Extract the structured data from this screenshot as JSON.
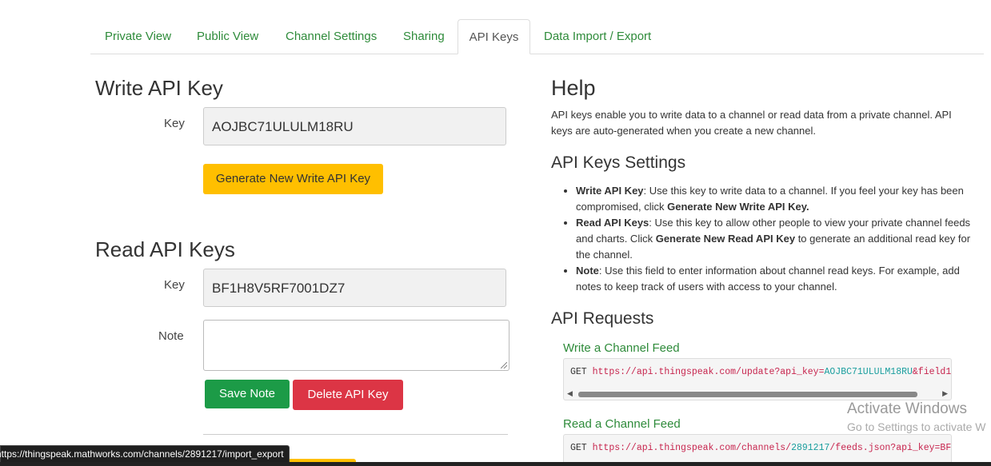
{
  "tabs": [
    {
      "label": "Private View"
    },
    {
      "label": "Public View"
    },
    {
      "label": "Channel Settings"
    },
    {
      "label": "Sharing"
    },
    {
      "label": "API Keys"
    },
    {
      "label": "Data Import / Export"
    }
  ],
  "write": {
    "heading": "Write API Key",
    "key_label": "Key",
    "key_value": "AOJBC71ULULM18RU",
    "generate_label": "Generate New Write API Key"
  },
  "read": {
    "heading": "Read API Keys",
    "key_label": "Key",
    "key_value": "BF1H8V5RF7001DZ7",
    "note_label": "Note",
    "note_value": "",
    "save_label": "Save Note",
    "delete_label": "Delete API Key"
  },
  "help": {
    "heading": "Help",
    "intro": "API keys enable you to write data to a channel or read data from a private channel. API keys are auto-generated when you create a new channel.",
    "settings_heading": "API Keys Settings",
    "settings": [
      {
        "term": "Write API Key",
        "pre": ": Use this key to write data to a channel. If you feel your key has been compromised, click ",
        "bold": "Generate New Write API Key.",
        "post": ""
      },
      {
        "term": "Read API Keys",
        "pre": ": Use this key to allow other people to view your private channel feeds and charts. Click ",
        "bold": "Generate New Read API Key",
        "post": " to generate an additional read key for the channel."
      },
      {
        "term": "Note",
        "pre": ": Use this field to enter information about channel read keys. For example, add notes to keep track of users with access to your channel.",
        "bold": "",
        "post": ""
      }
    ],
    "requests_heading": "API Requests",
    "write_feed_label": "Write a Channel Feed",
    "write_feed": {
      "method": "GET",
      "url1": "https://api.thingspeak.com/update?api_key=",
      "key": "AOJBC71ULULM18RU",
      "url2": "&field1"
    },
    "read_feed_label": "Read a Channel Feed",
    "read_feed": {
      "method": "GET",
      "url1": "https://api.thingspeak.com/channels/",
      "key": "2891217",
      "url2": "/feeds.json?api_key=BF"
    }
  },
  "statusbar": {
    "url": "https://thingspeak.mathworks.com/channels/2891217/import_export"
  },
  "watermark": {
    "line1": "Activate Windows",
    "line2": "Go to Settings to activate W"
  },
  "colors": {
    "accent_green": "#2e8b3a",
    "generate_yellow": "#ffbf00",
    "save_green": "#1c9b47",
    "delete_red": "#dc3545"
  }
}
